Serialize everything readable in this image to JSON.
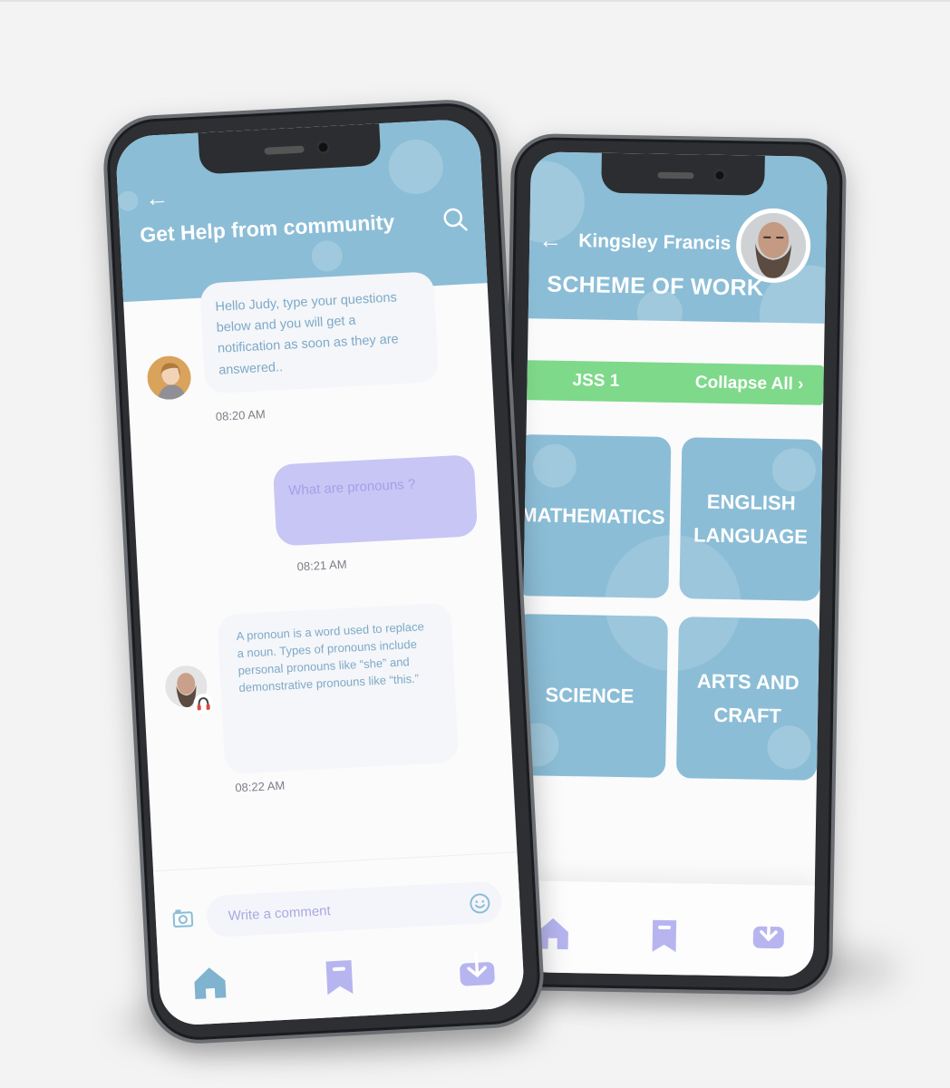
{
  "chat_screen": {
    "title": "Get Help from community",
    "messages": [
      {
        "side": "incoming",
        "text": "Hello Judy, type your questions below and you will get a notification as soon as they are answered..",
        "time": "08:20 AM"
      },
      {
        "side": "outgoing",
        "text": "What are pronouns ?",
        "time": "08:21 AM"
      },
      {
        "side": "incoming",
        "text": "A pronoun is a word used to replace a noun. Types of pronouns include personal pronouns like “she” and demonstrative pronouns like “this.”",
        "time": "08:22 AM"
      }
    ],
    "comment_placeholder": "Write a comment",
    "nav": [
      "home-icon",
      "bookmark-icon",
      "download-icon"
    ]
  },
  "scheme_screen": {
    "teacher_name": "Kingsley Francis",
    "title": "SCHEME OF WORK",
    "class_label": "JSS 1",
    "collapse_label": "Collapse All ›",
    "subjects": [
      "MATHEMATICS",
      "ENGLISH LANGUAGE",
      "SCIENCE",
      "ARTS AND CRAFT"
    ],
    "nav": [
      "home-icon",
      "bookmark-icon",
      "download-icon"
    ]
  },
  "colors": {
    "header_blue": "#8bbdd6",
    "accent_green": "#7ed98a",
    "outgoing_bubble": "#c8c6f5",
    "nav_icon_active": "#7fb3cf",
    "nav_icon_inactive": "#b7b5f0"
  }
}
